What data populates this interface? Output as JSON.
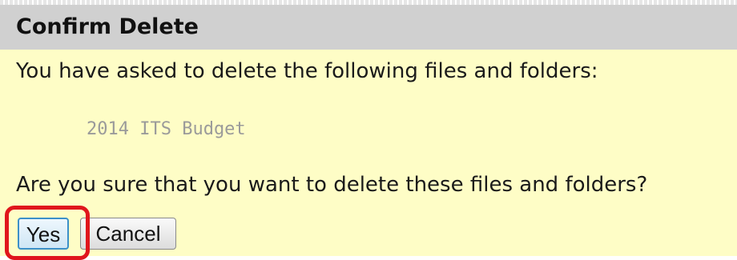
{
  "dialog": {
    "title": "Confirm Delete",
    "message": "You have asked to delete the following files and folders:",
    "files": [
      "2014 ITS Budget"
    ],
    "confirm_question": "Are you sure that you want to delete these files and folders?",
    "buttons": {
      "yes_label": "Yes",
      "cancel_label": "Cancel"
    }
  },
  "colors": {
    "background": "#fefdc6",
    "title_bar": "#d0d0d0",
    "highlight": "#e0161c",
    "file_text": "#9a9a9a"
  }
}
